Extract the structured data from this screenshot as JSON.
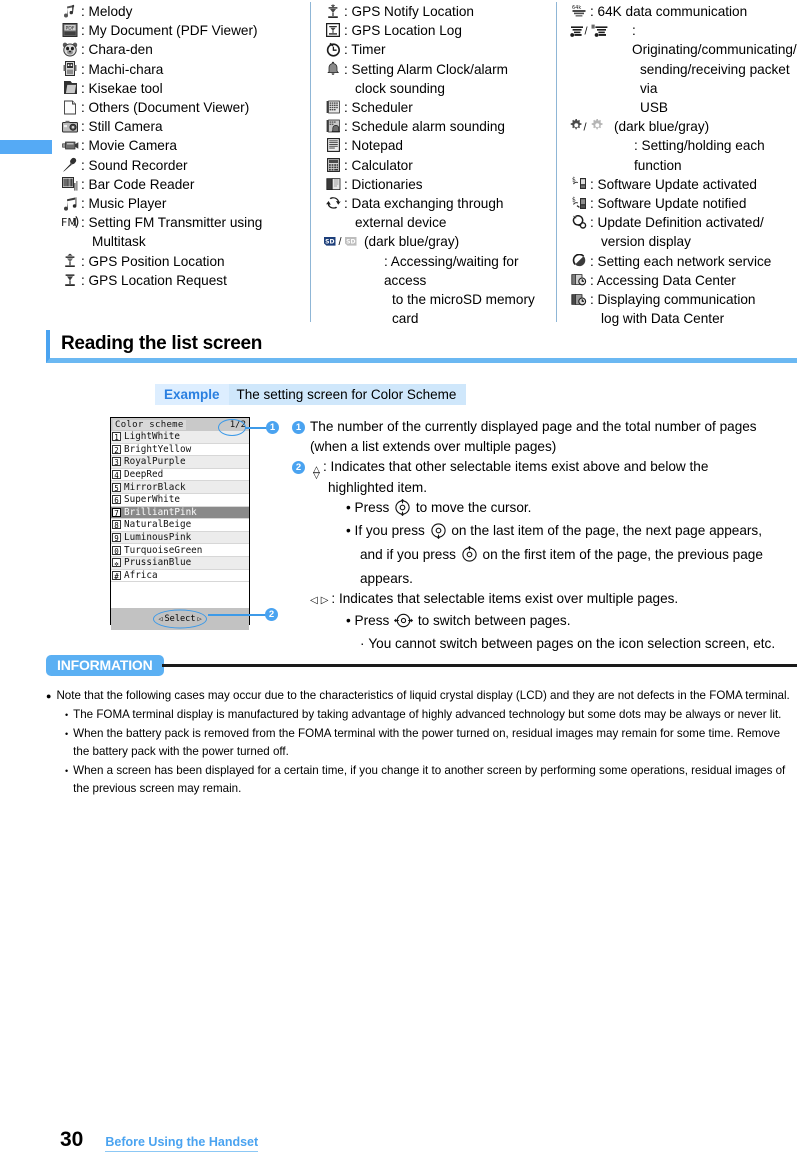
{
  "legend": {
    "columns": [
      {
        "id": "col-1",
        "entries": [
          {
            "icon": "melody-note-icon",
            "text": ": Melody"
          },
          {
            "icon": "pdf-document-icon",
            "text": ": My Document (PDF Viewer)"
          },
          {
            "icon": "chara-den-icon",
            "text": ": Chara-den"
          },
          {
            "icon": "machi-chara-icon",
            "text": ": Machi-chara"
          },
          {
            "icon": "kisekae-tool-icon",
            "text": ": Kisekae tool"
          },
          {
            "icon": "document-viewer-icon",
            "text": ": Others (Document Viewer)"
          },
          {
            "icon": "still-camera-icon",
            "text": ": Still Camera"
          },
          {
            "icon": "movie-camera-icon",
            "text": ": Movie Camera"
          },
          {
            "icon": "sound-recorder-icon",
            "text": ": Sound Recorder"
          },
          {
            "icon": "bar-code-reader-icon",
            "text": ": Bar Code Reader"
          },
          {
            "icon": "music-player-icon",
            "text": ": Music Player"
          },
          {
            "icon": "fm-transmitter-icon",
            "text": ": Setting FM Transmitter using",
            "cont": "Multitask"
          },
          {
            "icon": "gps-position-location-icon",
            "text": ": GPS Position Location"
          },
          {
            "icon": "gps-location-request-icon",
            "text": ": GPS Location Request"
          }
        ]
      },
      {
        "id": "col-2",
        "entries": [
          {
            "icon": "gps-notify-location-icon",
            "text": ": GPS Notify Location"
          },
          {
            "icon": "gps-location-log-icon",
            "text": ": GPS Location Log"
          },
          {
            "icon": "timer-icon",
            "text": ": Timer"
          },
          {
            "icon": "alarm-bell-icon",
            "text": ": Setting Alarm Clock/alarm",
            "cont": "clock sounding"
          },
          {
            "icon": "scheduler-icon",
            "text": ": Scheduler"
          },
          {
            "icon": "schedule-alarm-icon",
            "text": ": Schedule alarm sounding"
          },
          {
            "icon": "notepad-icon",
            "text": ": Notepad"
          },
          {
            "icon": "calculator-icon",
            "text": ": Calculator"
          },
          {
            "icon": "dictionaries-icon",
            "text": ": Dictionaries"
          },
          {
            "icon": "data-exchange-icon",
            "text": ": Data exchanging through",
            "cont": "external device"
          },
          {
            "icon": "microsd-pair-icon",
            "text": " (dark blue/gray)",
            "sub": ": Accessing/waiting for access",
            "sub2": "to the microSD memory card"
          }
        ]
      },
      {
        "id": "col-3",
        "entries": [
          {
            "icon": "data-64k-icon",
            "text": ": 64K data communication"
          },
          {
            "icon": "usb-packet-pair-icon",
            "text": "",
            "sub": ": Originating/communicating/",
            "sub2": "sending/receiving packet via",
            "sub3": "USB"
          },
          {
            "icon": "gear-pair-icon",
            "text": " (dark blue/gray)",
            "sub": ": Setting/holding each function"
          },
          {
            "icon": "software-update-activated-icon",
            "text": ": Software Update activated"
          },
          {
            "icon": "software-update-notified-icon",
            "text": ": Software Update notified"
          },
          {
            "icon": "update-definition-icon",
            "text": ": Update Definition activated/",
            "cont": "version display"
          },
          {
            "icon": "network-service-icon",
            "text": ": Setting each network service"
          },
          {
            "icon": "accessing-data-center-icon",
            "text": ": Accessing Data Center"
          },
          {
            "icon": "data-center-log-icon",
            "text": ": Displaying communication",
            "cont": "log with Data Center"
          }
        ]
      }
    ]
  },
  "section": {
    "heading": "Reading the list screen",
    "example_tag": "Example",
    "example_text": "The setting screen for Color Scheme"
  },
  "phone": {
    "title": "Color scheme",
    "page_indicator": "1/2",
    "items": [
      {
        "key": "1",
        "label": "LightWhite"
      },
      {
        "key": "2",
        "label": "BrightYellow"
      },
      {
        "key": "3",
        "label": "RoyalPurple"
      },
      {
        "key": "4",
        "label": "DeepRed"
      },
      {
        "key": "5",
        "label": "MirrorBlack"
      },
      {
        "key": "6",
        "label": "SuperWhite"
      },
      {
        "key": "7",
        "label": "BrilliantPink"
      },
      {
        "key": "8",
        "label": "NaturalBeige"
      },
      {
        "key": "9",
        "label": "LuminousPink"
      },
      {
        "key": "0",
        "label": "TurquoiseGreen"
      },
      {
        "key": "✲",
        "label": "PrussianBlue"
      },
      {
        "key": "#",
        "label": "Africa"
      }
    ],
    "selected_index": 6,
    "softkey": "Select",
    "callout_1": "1",
    "callout_2": "2"
  },
  "annotations": {
    "item1": {
      "badge": "1",
      "line1": "The number of the currently displayed page and the total number of pages",
      "line2": "(when a list extends over multiple pages)"
    },
    "item2": {
      "badge": "2",
      "line1": ":  Indicates that other selectable items exist above and below the",
      "line2": "highlighted item.",
      "bullet1_pre": "Press",
      "bullet1_post": "to move the cursor.",
      "bullet2_pre": "If you press",
      "bullet2_mid": "on the last item of the page, the next page appears,",
      "bullet2_mid2": "and if you press",
      "bullet2_post": "on the first item of the page, the previous page",
      "bullet2_end": "appears."
    },
    "item3": {
      "line1": ":  Indicates that selectable items exist over multiple pages.",
      "bullet1_pre": "Press",
      "bullet1_post": "to switch between pages.",
      "note": "You cannot switch between pages on the icon selection screen, etc."
    }
  },
  "information": {
    "title": "INFORMATION",
    "notes": [
      {
        "type": "main",
        "text": "Note that the following cases may occur due to the characteristics of liquid crystal display (LCD) and they are not defects in the FOMA terminal."
      },
      {
        "type": "sub",
        "text": "The FOMA terminal display is manufactured by taking advantage of highly advanced technology but some dots may be always or never lit."
      },
      {
        "type": "sub",
        "text": "When the battery pack is removed from the FOMA terminal with the power turned on, residual images may remain for some time. Remove the battery pack with the power turned off."
      },
      {
        "type": "sub",
        "text": "When a screen has been displayed for a certain time, if you change it to another screen by performing some operations, residual images of the previous screen may remain."
      }
    ]
  },
  "footer": {
    "page_number": "30",
    "breadcrumb": "Before Using the Handset"
  },
  "colors": {
    "accent_blue": "#4aa3f0",
    "light_blue": "#cfe7fb",
    "rule_blue": "#6bb8f2"
  }
}
